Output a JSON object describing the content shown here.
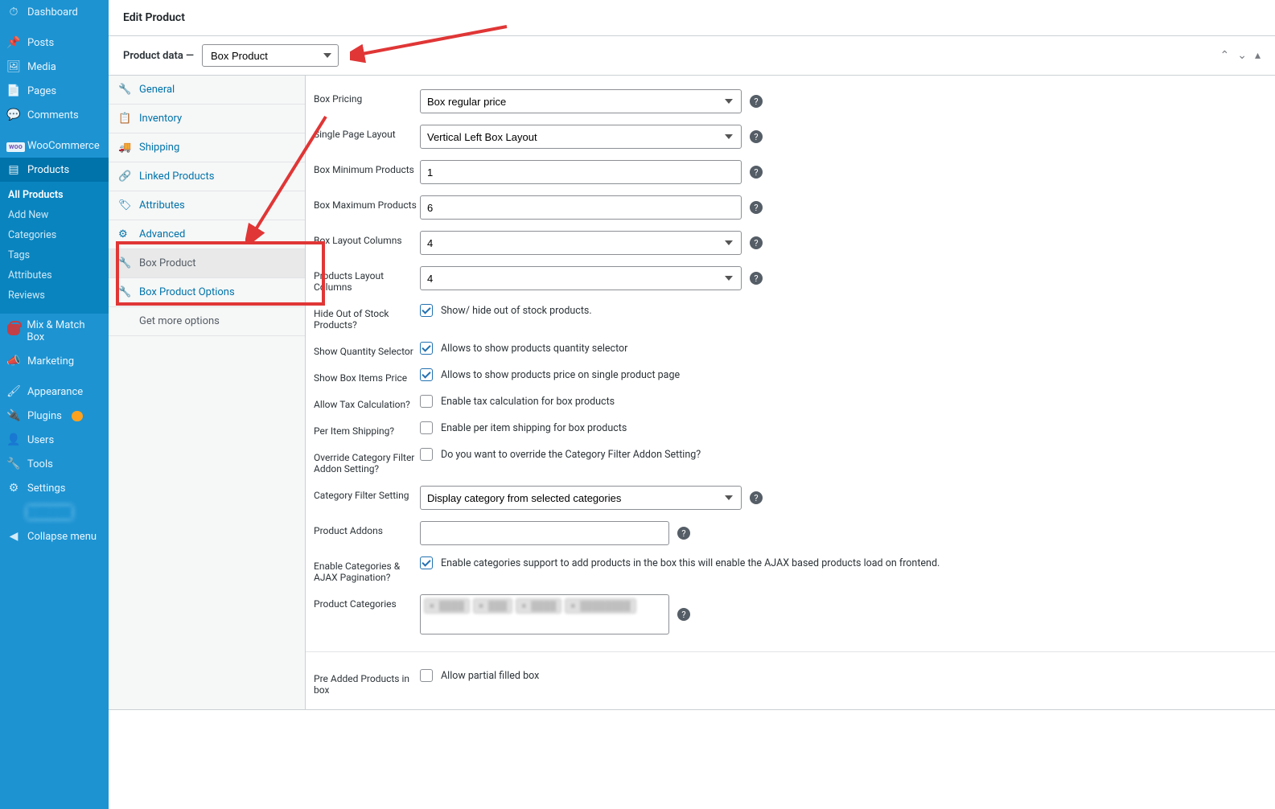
{
  "page": {
    "title": "Edit Product"
  },
  "admin_menu": {
    "dashboard": "Dashboard",
    "posts": "Posts",
    "media": "Media",
    "pages": "Pages",
    "comments": "Comments",
    "woocommerce": "WooCommerce",
    "products": "Products",
    "products_sub": {
      "all": "All Products",
      "add": "Add New",
      "categories": "Categories",
      "tags": "Tags",
      "attributes": "Attributes",
      "reviews": "Reviews"
    },
    "mix_match": "Mix & Match Box",
    "marketing": "Marketing",
    "appearance": "Appearance",
    "plugins": "Plugins",
    "users": "Users",
    "tools": "Tools",
    "settings": "Settings",
    "collapse": "Collapse menu"
  },
  "product_data": {
    "label": "Product data —",
    "type_value": "Box Product",
    "tabs": {
      "general": "General",
      "inventory": "Inventory",
      "shipping": "Shipping",
      "linked": "Linked Products",
      "attributes": "Attributes",
      "advanced": "Advanced",
      "box_product": "Box Product",
      "box_product_options": "Box Product Options",
      "get_more": "Get more options"
    }
  },
  "form": {
    "box_pricing": {
      "label": "Box Pricing",
      "value": "Box regular price"
    },
    "layout": {
      "label": "Single Page Layout",
      "value": "Vertical Left Box Layout"
    },
    "min": {
      "label": "Box Minimum Products",
      "value": "1"
    },
    "max": {
      "label": "Box Maximum Products",
      "value": "6"
    },
    "box_cols": {
      "label": "Box Layout Columns",
      "value": "4"
    },
    "prod_cols": {
      "label": "Products Layout Columns",
      "value": "4"
    },
    "hide_oos": {
      "label": "Hide Out of Stock Products?",
      "checked": true,
      "desc": "Show/ hide out of stock products."
    },
    "qty_sel": {
      "label": "Show Quantity Selector",
      "checked": true,
      "desc": "Allows to show products quantity selector"
    },
    "items_price": {
      "label": "Show Box Items Price",
      "checked": true,
      "desc": "Allows to show products price on single product page"
    },
    "tax": {
      "label": "Allow Tax Calculation?",
      "checked": false,
      "desc": "Enable tax calculation for box products"
    },
    "per_ship": {
      "label": "Per Item Shipping?",
      "checked": false,
      "desc": "Enable per item shipping for box products"
    },
    "override_cat": {
      "label": "Override Category Filter Addon Setting?",
      "checked": false,
      "desc": "Do you want to override the Category Filter Addon Setting?"
    },
    "cat_filter": {
      "label": "Category Filter Setting",
      "value": "Display category from selected categories"
    },
    "addons": {
      "label": "Product Addons"
    },
    "enable_cat_ajax": {
      "label": "Enable Categories & AJAX Pagination?",
      "checked": true,
      "desc": "Enable categories support to add products in the box this will enable the AJAX based products load on frontend."
    },
    "prod_cats": {
      "label": "Product Categories"
    },
    "pre_added": {
      "label": "Pre Added Products in box",
      "checked": false,
      "desc": "Allow partial filled box"
    }
  }
}
